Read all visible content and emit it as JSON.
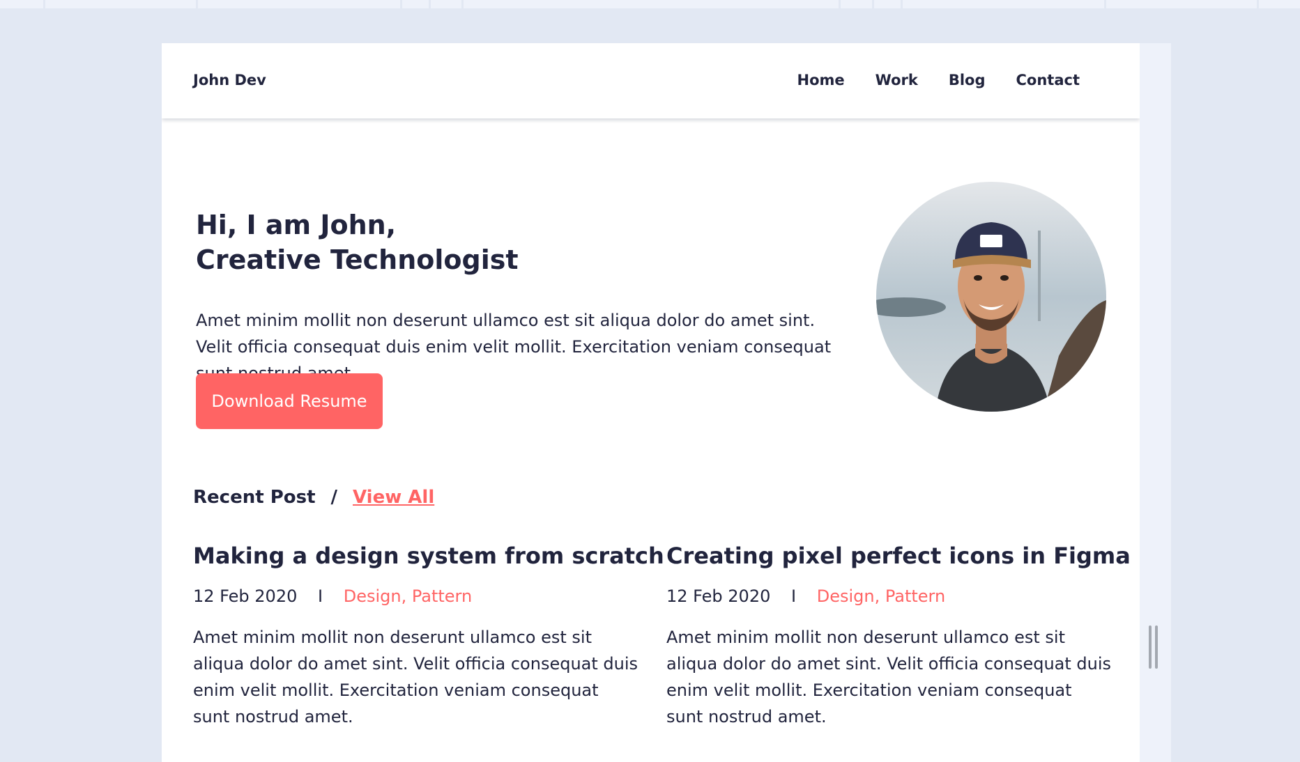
{
  "header": {
    "brand": "John Dev",
    "nav": [
      "Home",
      "Work",
      "Blog",
      "Contact"
    ]
  },
  "hero": {
    "title_line1": "Hi, I am John,",
    "title_line2": "Creative Technologist",
    "description": "Amet minim mollit non deserunt ullamco est sit aliqua dolor do amet sint. Velit officia consequat duis enim velit mollit. Exercitation veniam consequat sunt nostrud amet.",
    "button_label": "Download Resume"
  },
  "recent": {
    "label": "Recent Post",
    "separator": "/",
    "view_all": "View All"
  },
  "posts": [
    {
      "title": "Making a design system from scratch",
      "date": "12 Feb 2020",
      "separator": "I",
      "tags": "Design, Pattern",
      "excerpt": "Amet minim mollit non deserunt ullamco est sit aliqua dolor do amet sint. Velit officia consequat duis enim velit mollit. Exercitation veniam consequat sunt nostrud amet."
    },
    {
      "title": "Creating pixel perfect icons in Figma",
      "date": "12 Feb 2020",
      "separator": "I",
      "tags": "Design, Pattern",
      "excerpt": "Amet minim mollit non deserunt ullamco est sit aliqua dolor do amet sint. Velit officia consequat duis enim velit mollit. Exercitation veniam consequat sunt nostrud amet."
    }
  ],
  "colors": {
    "accent": "#ff6464",
    "text": "#21243d",
    "background": "#e2e8f3"
  },
  "icons": {
    "avatar": "profile-photo"
  }
}
